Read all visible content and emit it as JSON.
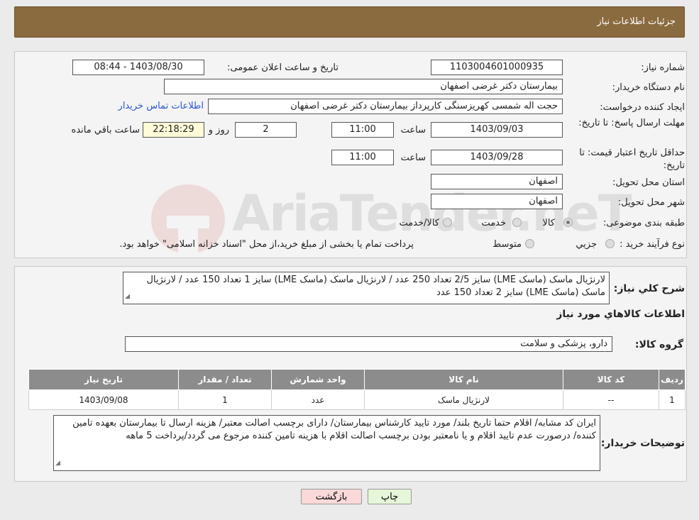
{
  "header": {
    "title": "جزئیات اطلاعات نیاز"
  },
  "form": {
    "need_number_label": "شماره نیاز:",
    "need_number": "1103004601000935",
    "announce_label": "تاریخ و ساعت اعلان عمومی:",
    "announce_value": "1403/08/30 - 08:44",
    "buyer_org_label": "نام دستگاه خریدار:",
    "buyer_org": "بیمارستان دکتر غرضی اصفهان",
    "creator_label": "ایجاد کننده درخواست:",
    "creator": "حجت اله شمسی کهریزسنگی کارپرداز بیمارستان دکتر غرضی اصفهان",
    "contact_link": "اطلاعات تماس خریدار",
    "reply_deadline_label": "مهلت ارسال پاسخ: تا تاریخ:",
    "reply_date": "1403/09/03",
    "time_label": "ساعت",
    "reply_time": "11:00",
    "days_value": "2",
    "days_label": "روز و",
    "remaining_time": "22:18:29",
    "remaining_label": "ساعت باقي مانده",
    "validity_label": "حداقل تاریخ اعتبار قیمت: تا تاریخ:",
    "validity_date": "1403/09/28",
    "validity_time": "11:00",
    "province_label": "استان محل تحویل:",
    "province": "اصفهان",
    "city_label": "شهر محل تحویل:",
    "city": "اصفهان",
    "category_label": "طبقه بندی موضوعی:",
    "category_options": [
      "کالا",
      "خدمت",
      "کالا/خدمت"
    ],
    "purchase_type_label": "نوع فرآیند خرید :",
    "purchase_options": [
      "جزیي",
      "متوسط"
    ],
    "purchase_note": "پرداخت تمام یا بخشی از مبلغ خرید،از محل \"اسناد خزانه اسلامی\" خواهد بود."
  },
  "description": {
    "label": "شرح کلي نیاز:",
    "text": "لارنژیال ماسک (ماسک LME) سایز 2/5 تعداد 250 عدد / لارنژیال ماسک (ماسک LME) سایز 1 تعداد 150 عدد / لارنژیال ماسک (ماسک LME) سایز 2 تعداد 150 عدد"
  },
  "items_section": {
    "title": "اطلاعات کالاهاي مورد نیاز",
    "group_label": "گروه کالا:",
    "group_value": "دارو، پزشکی و سلامت",
    "columns": [
      "ردیف",
      "کد کالا",
      "نام کالا",
      "واحد شمارش",
      "تعداد / مقدار",
      "تاریخ نیاز"
    ],
    "rows": [
      [
        "1",
        "--",
        "لارنژیال ماسک",
        "عدد",
        "1",
        "1403/09/08"
      ]
    ]
  },
  "buyer_notes": {
    "label": "توضیحات خریدار:",
    "text": "ایران کد مشابه/ اقلام حتما تاریخ بلند/ مورد تایید کارشناس بیمارستان/ دارای برچسب اصالت معتبر/ هزینه ارسال تا بیمارستان بعهده تامین کننده/ درصورت عدم تایید اقلام و یا نامعتبر بودن برچسب اصالت اقلام با هزینه تامین کننده مرجوع می گردد/پرداخت 5 ماهه"
  },
  "buttons": {
    "print": "چاپ",
    "back": "بازگشت"
  },
  "watermark": {
    "text": "AriaTender.neT"
  },
  "colors": {
    "header_bg": "#8a6a3f",
    "link": "#2a55d0",
    "back_button_bg": "#fbd9d9",
    "print_button_bg": "#e6f6d8"
  }
}
